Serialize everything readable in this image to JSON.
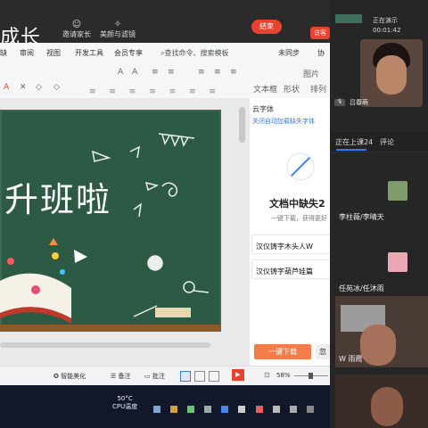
{
  "share": {
    "title_partial": "成长",
    "top_icons": [
      "邀请家长",
      "美颜与滤镜"
    ],
    "stop_label": "结束",
    "top_right_label": "访客",
    "menu": [
      "缺",
      "审阅",
      "视图",
      "开发工具",
      "会员专享",
      "查找命令、搜索模板",
      "未同步",
      "协"
    ],
    "toolbar": {
      "left_row1": [
        "A",
        "A",
        "≡",
        "≡",
        "≡",
        "≡",
        "≡"
      ],
      "left_row2": [
        "A",
        "✕",
        "◇",
        "◇"
      ],
      "right": [
        "图片",
        "文本框",
        "形状",
        "排列"
      ]
    },
    "slide_title": "升班啦",
    "right_panel": {
      "header": "云字体",
      "subheader": "关闭自动加载缺失字体",
      "title": "文档中缺失2",
      "sub": "一键下载，获得更好",
      "fonts": [
        "汉仪铸字木头人W",
        "汉仪铸字葫芦娃篇"
      ],
      "download_btn": "一键下载",
      "second_btn": "忽"
    },
    "statusbar": {
      "smart": "智能美化",
      "notes": "备注",
      "comments": "批注",
      "zoom": "58%"
    },
    "taskbar": {
      "temp": "50°C",
      "cpu_label": "CPU温度"
    }
  },
  "meeting": {
    "presenter_status": "正在演示",
    "timer": "00:01:42",
    "presenter_name": "吕春萌",
    "tabs": [
      "正在上课24",
      "评论"
    ],
    "attendees": [
      {
        "name": "李柱薇/李晴天"
      },
      {
        "name": "任苑冰/任沐雨"
      },
      {
        "name": "W 雨霞"
      }
    ]
  },
  "colors": {
    "chalkboard": "#2c5a44",
    "accent_red": "#e8432f",
    "accent_blue": "#2b7cff",
    "download_btn": "#f47b4a"
  }
}
